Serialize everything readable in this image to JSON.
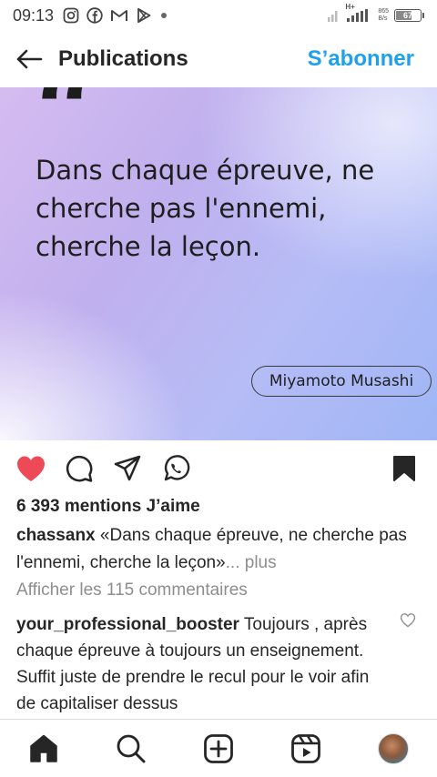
{
  "status_bar": {
    "time": "09:13",
    "network_type": "H+",
    "net_speed_value": "865",
    "net_speed_unit": "B/s",
    "battery_level": "67",
    "icons": [
      "instagram-icon",
      "facebook-icon",
      "gmail-icon",
      "play-store-icon",
      "dot-icon",
      "signal-icon",
      "signal-icon-2"
    ]
  },
  "header": {
    "title": "Publications",
    "subscribe_label": "S’abonner"
  },
  "post": {
    "quote_mark": "“",
    "quote_text": "Dans chaque épreuve, ne cherche pas l'ennemi, cherche la leçon.",
    "author": "Miyamoto Musashi",
    "liked": true,
    "saved": true,
    "likes_text": "6 393 mentions J’aime",
    "caption_username": "chassanx",
    "caption_text": " «Dans chaque épreuve, ne cherche pas l'ennemi, cherche la leçon»",
    "caption_more": "... plus",
    "view_comments_label": "Afficher les 115 commentaires",
    "comment_username": "your_professional_booster",
    "comment_text": " Toujours , après chaque épreuve à toujours un enseignement. Suffit juste de prendre le recul pour le voir afin de capitaliser dessus"
  },
  "colors": {
    "accent": "#1da0ef",
    "like_red": "#ed4956",
    "text": "#262626",
    "secondary_text": "#8e8e8e"
  },
  "bottom_nav": {
    "items": [
      "home-icon",
      "search-icon",
      "create-post-icon",
      "reels-icon",
      "profile-avatar"
    ]
  }
}
